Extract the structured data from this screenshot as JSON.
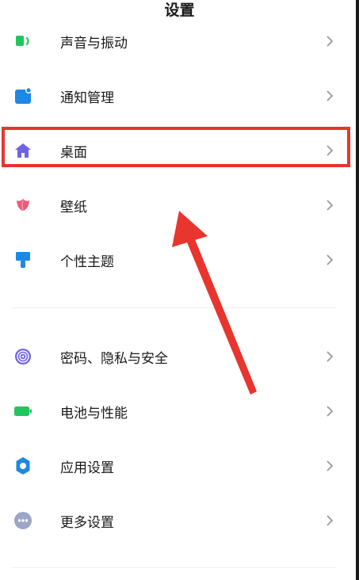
{
  "header": {
    "title": "设置"
  },
  "settings_items": [
    {
      "label": "声音与振动",
      "icon": "speaker-icon",
      "color": "#22c55e"
    },
    {
      "label": "通知管理",
      "icon": "notification-icon",
      "color": "#1e88e5"
    },
    {
      "label": "桌面",
      "icon": "home-icon",
      "color": "#6f62e8"
    },
    {
      "label": "壁纸",
      "icon": "flower-icon",
      "color": "#ef5b7a"
    },
    {
      "label": "个性主题",
      "icon": "paintbrush-icon",
      "color": "#1e88e5"
    },
    {
      "label": "密码、隐私与安全",
      "icon": "fingerprint-icon",
      "color": "#6f62e8"
    },
    {
      "label": "电池与性能",
      "icon": "battery-icon",
      "color": "#22c55e"
    },
    {
      "label": "应用设置",
      "icon": "gear-icon",
      "color": "#1e88e5"
    },
    {
      "label": "更多设置",
      "icon": "more-icon",
      "color": "#9aa6c7"
    }
  ],
  "annotation": {
    "highlight_color": "#e8352d"
  }
}
